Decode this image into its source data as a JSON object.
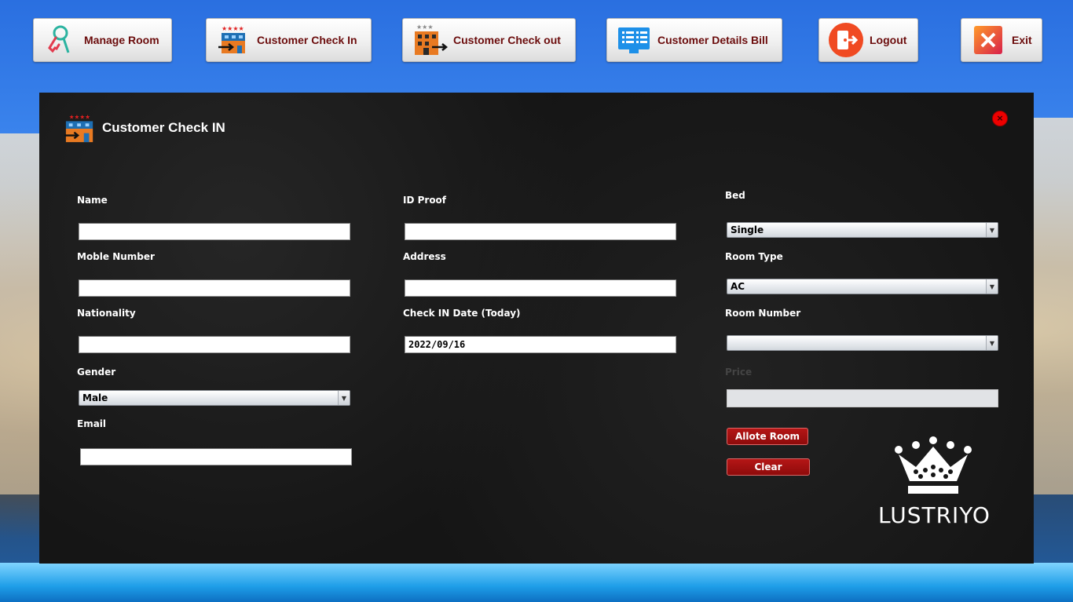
{
  "toolbar": {
    "manage_room": "Manage Room",
    "check_in": "Customer Check In",
    "check_out": "Customer Check out",
    "details_bill": "Customer Details Bill",
    "logout": "Logout",
    "exit": "Exit"
  },
  "panel": {
    "title": "Customer  Check IN",
    "close_symbol": "×"
  },
  "form": {
    "name": {
      "label": "Name",
      "value": ""
    },
    "mobile": {
      "label": "Moble Number",
      "value": ""
    },
    "nationality": {
      "label": "Nationality",
      "value": ""
    },
    "gender": {
      "label": "Gender",
      "value": "Male"
    },
    "email": {
      "label": "Email",
      "value": ""
    },
    "id_proof": {
      "label": "ID Proof",
      "value": ""
    },
    "address": {
      "label": "Address",
      "value": ""
    },
    "checkin_date": {
      "label": "Check IN Date (Today)",
      "value": "2022/09/16"
    },
    "bed": {
      "label": "Bed",
      "value": "Single"
    },
    "room_type": {
      "label": "Room Type",
      "value": "AC"
    },
    "room_number": {
      "label": "Room Number",
      "value": ""
    },
    "price": {
      "label": "Price",
      "value": ""
    }
  },
  "actions": {
    "allot": "Allote  Room",
    "clear": "Clear"
  },
  "brand": "LUSTRIYO",
  "colors": {
    "accent_red": "#8e0b0b",
    "button_text": "#6b0c0c",
    "panel_bg": "#151515"
  }
}
